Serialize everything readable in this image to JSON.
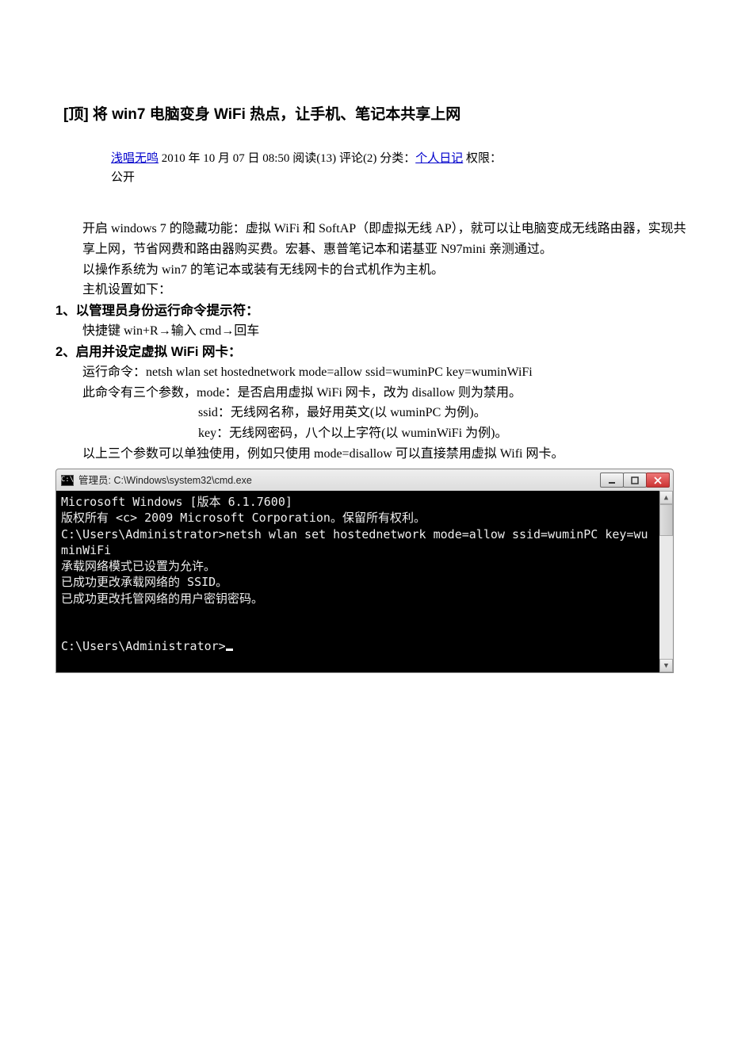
{
  "title": "[顶] 将 win7 电脑变身 WiFi 热点，让手机、笔记本共享上网",
  "meta": {
    "author": "浅唱无鸣",
    "date": "2010 年 10 月 07 日 08:50",
    "reads_label": "阅读(13)",
    "comments_label": "评论(2)",
    "category_prefix": "分类：",
    "category_link": "个人日记",
    "perm_label": "权限：",
    "perm_value": "公开"
  },
  "intro": {
    "p1": "开启 windows 7 的隐藏功能：虚拟 WiFi 和 SoftAP（即虚拟无线 AP），就可以让电脑变成无线路由器，实现共享上网，节省网费和路由器购买费。宏碁、惠普笔记本和诺基亚 N97mini 亲测通过。",
    "p2": "以操作系统为 win7 的笔记本或装有无线网卡的台式机作为主机。",
    "p3": "主机设置如下："
  },
  "step1": {
    "heading": "1、以管理员身份运行命令提示符：",
    "body": "快捷键 win+R→输入 cmd→回车"
  },
  "step2": {
    "heading": "2、启用并设定虚拟 WiFi 网卡：",
    "line1": "运行命令：netsh wlan set hostednetwork mode=allow ssid=wuminPC key=wuminWiFi",
    "line2": "此命令有三个参数，mode：是否启用虚拟 WiFi 网卡，改为 disallow 则为禁用。",
    "line3": "ssid：无线网名称，最好用英文(以 wuminPC 为例)。",
    "line4": "key：无线网密码，八个以上字符(以 wuminWiFi 为例)。",
    "line5": "以上三个参数可以单独使用，例如只使用 mode=disallow 可以直接禁用虚拟 Wifi 网卡。"
  },
  "cmd": {
    "window_title": "管理员: C:\\Windows\\system32\\cmd.exe",
    "lines": [
      "Microsoft Windows [版本 6.1.7600]",
      "版权所有 <c> 2009 Microsoft Corporation。保留所有权利。",
      "",
      "C:\\Users\\Administrator>netsh wlan set hostednetwork mode=allow ssid=wuminPC key=wuminWiFi",
      "承载网络模式已设置为允许。",
      "已成功更改承载网络的 SSID。",
      "已成功更改托管网络的用户密钥密码。",
      "",
      "",
      "C:\\Users\\Administrator>"
    ]
  }
}
